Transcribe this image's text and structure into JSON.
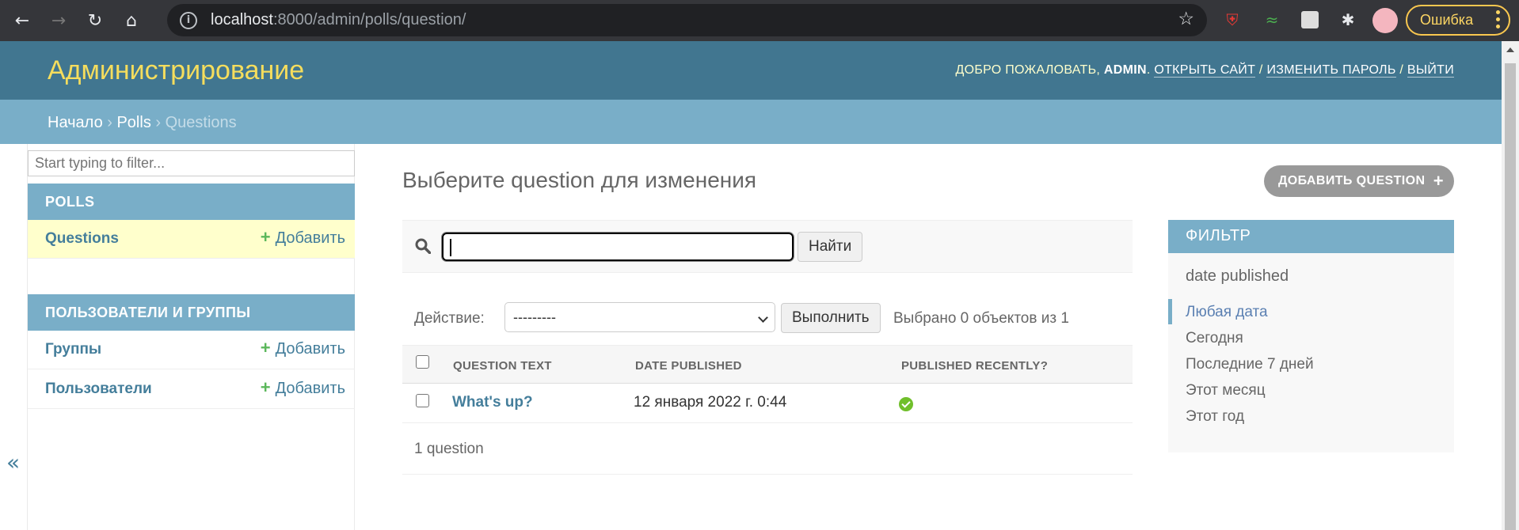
{
  "browser": {
    "url_host": "localhost",
    "url_rest": ":8000/admin/polls/question/",
    "error_label": "Ошибка"
  },
  "header": {
    "branding": "Администрирование",
    "welcome": "ДОБРО ПОЖАЛОВАТЬ, ",
    "username": "ADMIN",
    "view_site": "ОТКРЫТЬ САЙТ",
    "change_password": "ИЗМЕНИТЬ ПАРОЛЬ",
    "logout": "ВЫЙТИ",
    "sep": " / "
  },
  "breadcrumbs": {
    "home": "Начало",
    "app": "Polls",
    "current": "Questions",
    "sep": " › "
  },
  "sidebar": {
    "filter_placeholder": "Start typing to filter...",
    "modules": [
      {
        "caption": "POLLS",
        "rows": [
          {
            "name": "Questions",
            "add": "Добавить"
          }
        ]
      },
      {
        "caption": "ПОЛЬЗОВАТЕЛИ И ГРУППЫ",
        "rows": [
          {
            "name": "Группы",
            "add": "Добавить"
          },
          {
            "name": "Пользователи",
            "add": "Добавить"
          }
        ]
      }
    ],
    "collapse": "«"
  },
  "content": {
    "title": "Выберите question для изменения",
    "add_button": "ДОБАВИТЬ QUESTION",
    "search_button": "Найти",
    "action_label": "Действие:",
    "action_selected": "---------",
    "run_button": "Выполнить",
    "counter": "Выбрано 0 объектов из 1",
    "columns": [
      "QUESTION TEXT",
      "DATE PUBLISHED",
      "PUBLISHED RECENTLY?"
    ],
    "rows": [
      {
        "question_text": "What's up?",
        "date_published": "12 января 2022 г. 0:44",
        "published_recently": true
      }
    ],
    "paginator": "1 question"
  },
  "filter": {
    "title": "ФИЛЬТР",
    "field": "date published",
    "options": [
      "Любая дата",
      "Сегодня",
      "Последние 7 дней",
      "Этот месяц",
      "Этот год"
    ],
    "selected_index": 0
  },
  "colors": {
    "header_bg": "#417690",
    "breadcrumbs_bg": "#79aec8",
    "branding": "#f5dd5d",
    "link": "#447e9b",
    "current_row": "#ffffcc",
    "add_icon": "#5bb75b"
  }
}
